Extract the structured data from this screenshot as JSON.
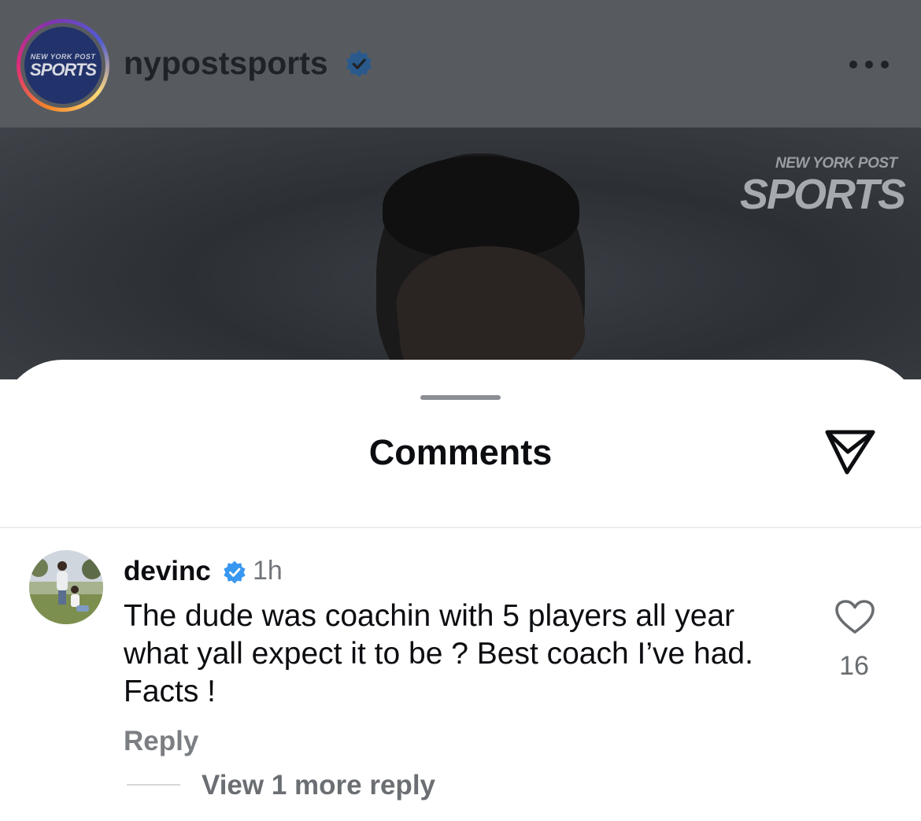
{
  "header": {
    "username": "nypostsports",
    "avatar_logo_small": "NEW YORK POST",
    "avatar_logo_large": "SPORTS"
  },
  "media": {
    "watermark_small": "NEW YORK POST",
    "watermark_large": "SPORTS"
  },
  "comments_sheet": {
    "title": "Comments",
    "comments": [
      {
        "username": "devinc",
        "time": "1h",
        "text": "The dude was coachin with 5 players all year what yall expect it to be ? Best coach I’ve had. Facts !",
        "likes": "16",
        "reply_label": "Reply",
        "view_replies_label": "View 1 more reply"
      }
    ]
  },
  "colors": {
    "verified_blue": "#3897f0",
    "header_gray": "#575b60",
    "text_primary": "#0b0d10",
    "text_secondary": "#737679"
  },
  "icons": {
    "verified": "verified-badge-icon",
    "more": "more-dots-icon",
    "share": "paper-plane-icon",
    "like": "heart-icon"
  }
}
